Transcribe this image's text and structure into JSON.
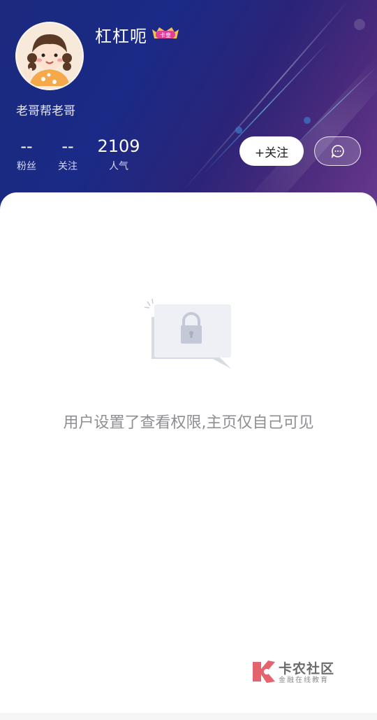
{
  "profile": {
    "username": "杠杠呃",
    "badge_text": "卡皇",
    "bio": "老哥帮老哥"
  },
  "stats": [
    {
      "value": "--",
      "label": "粉丝"
    },
    {
      "value": "--",
      "label": "关注"
    },
    {
      "value": "2109",
      "label": "人气"
    }
  ],
  "actions": {
    "follow_label": "+关注",
    "message_icon": "chat-bubble-icon"
  },
  "empty_state": {
    "icon": "lock-icon",
    "message": "用户设置了查看权限,主页仅自己可见"
  },
  "watermark": {
    "title": "卡农社区",
    "subtitle": "金融在线教育"
  },
  "colors": {
    "header_start": "#1b2a7e",
    "header_end": "#6a3a8f",
    "badge_pink": "#e0409a",
    "badge_gold": "#f2c14e",
    "empty_text": "#8e8e93"
  }
}
